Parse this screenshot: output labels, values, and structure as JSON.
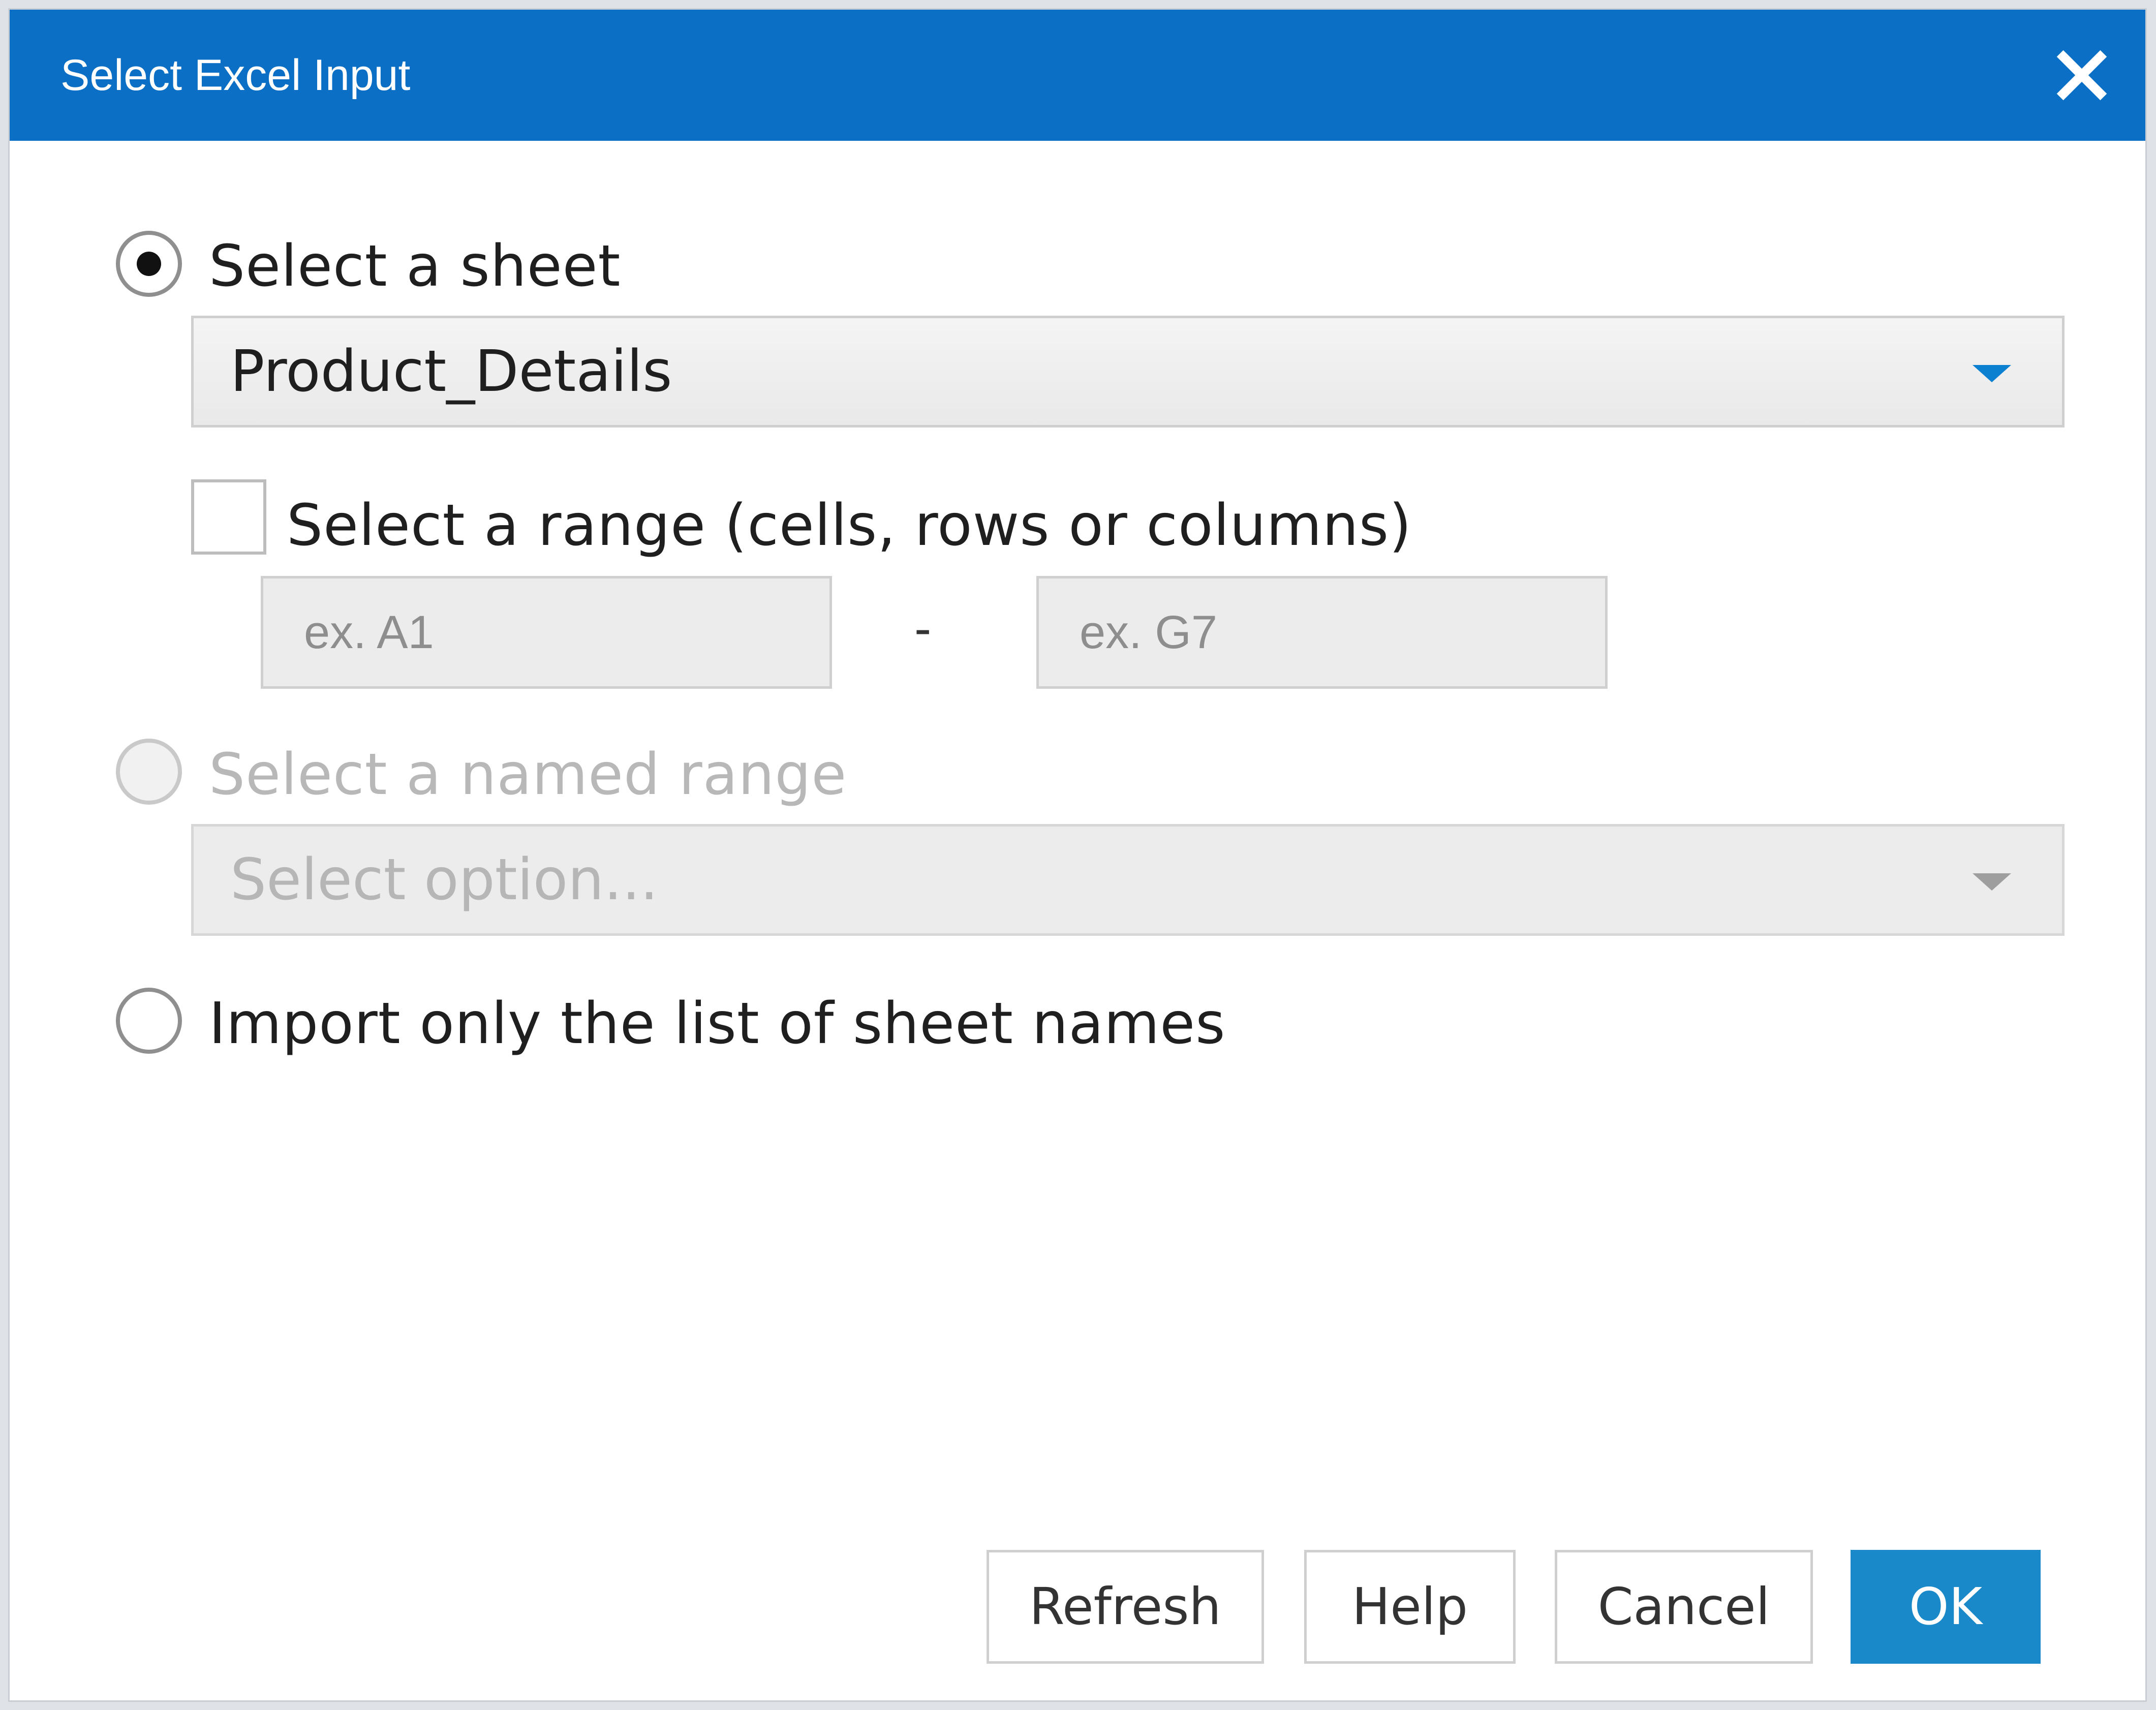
{
  "window": {
    "title": "Select Excel Input",
    "close_icon": "close-icon"
  },
  "options": {
    "sheet": {
      "label": "Select a sheet",
      "selected": true,
      "dropdown_value": "Product_Details"
    },
    "range": {
      "label": "Select a range (cells, rows or columns)",
      "checked": false,
      "start_placeholder": "ex. A1",
      "separator": "-",
      "end_placeholder": "ex. G7"
    },
    "named_range": {
      "label": "Select a named range",
      "selected": false,
      "disabled": true,
      "dropdown_placeholder": "Select option..."
    },
    "sheet_names": {
      "label": "Import only the list of sheet names",
      "selected": false
    }
  },
  "buttons": {
    "refresh": "Refresh",
    "help": "Help",
    "cancel": "Cancel",
    "ok": "OK"
  },
  "colors": {
    "titlebar": "#0b6fc5",
    "primary_button": "#1989c9",
    "dropdown_arrow": "#0b7fd0"
  }
}
